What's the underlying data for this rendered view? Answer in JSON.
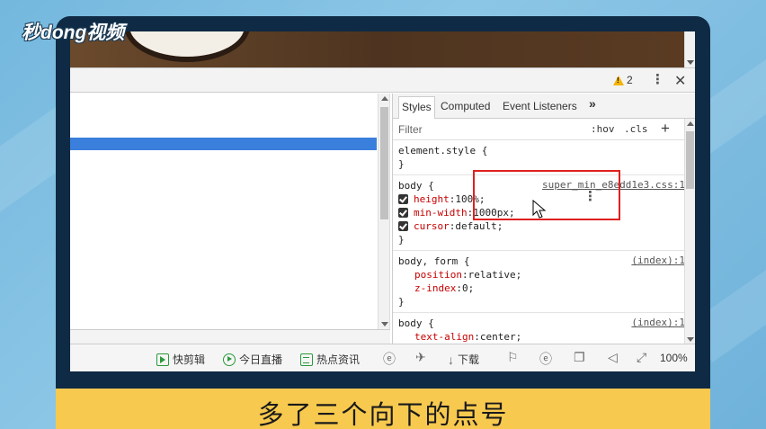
{
  "logo": {
    "text": "秒dong视频"
  },
  "devtools": {
    "warning_count": "2",
    "tabs": [
      "Styles",
      "Computed",
      "Event Listeners"
    ],
    "more_tabs": "»",
    "filter": {
      "placeholder": "Filter",
      "hov": ":hov",
      "cls": ".cls",
      "add": "+"
    },
    "rules": [
      {
        "selector": "element.style {",
        "source": "",
        "props": [],
        "close": "}"
      },
      {
        "selector": "body {",
        "source": "super_min_e8edd1e3.css:1",
        "props": [
          {
            "name": "height",
            "value": " 100%;"
          },
          {
            "name": "min-width",
            "value": " 1000px;"
          },
          {
            "name": "cursor",
            "value": " default;"
          }
        ],
        "close": "}"
      },
      {
        "selector": "body, form {",
        "source": "(index):1",
        "props": [
          {
            "name": "position",
            "value": " relative;"
          },
          {
            "name": "z-index",
            "value": " 0;"
          }
        ],
        "close": "}"
      },
      {
        "selector": "body {",
        "source": "(index):1",
        "props": [
          {
            "name": "text-align",
            "value": " center;"
          }
        ],
        "close": ""
      }
    ]
  },
  "statusbar": {
    "items": [
      "快剪辑",
      "今日直播",
      "热点资讯",
      "下载"
    ],
    "zoom": "100%"
  },
  "caption": "多了三个向下的点号",
  "colors": {
    "selection": "#3a7fdc",
    "highlight_box": "#e02020",
    "caption_bg": "#f7c94f",
    "frame": "#0f2a44"
  }
}
